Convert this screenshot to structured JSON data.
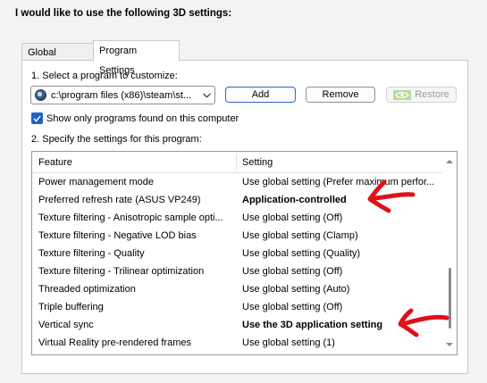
{
  "heading": "I would like to use the following 3D settings:",
  "tabs": [
    {
      "label": "Global Settings",
      "selected": false
    },
    {
      "label": "Program Settings",
      "selected": true
    }
  ],
  "step1": {
    "label": "1. Select a program to customize:",
    "program": "c:\\program files (x86)\\steam\\st...",
    "add_label": "Add",
    "remove_label": "Remove",
    "restore_label": "Restore"
  },
  "filter": {
    "checked": true,
    "label": "Show only programs found on this computer"
  },
  "step2": {
    "label": "2. Specify the settings for this program:",
    "columns": {
      "feature": "Feature",
      "setting": "Setting"
    },
    "rows": [
      {
        "feature": "Power management mode",
        "setting": "Use global setting (Prefer maximum perfor...",
        "bold": false
      },
      {
        "feature": "Preferred refresh rate (ASUS VP249)",
        "setting": "Application-controlled",
        "bold": true
      },
      {
        "feature": "Texture filtering - Anisotropic sample opti...",
        "setting": "Use global setting (Off)",
        "bold": false
      },
      {
        "feature": "Texture filtering - Negative LOD bias",
        "setting": "Use global setting (Clamp)",
        "bold": false
      },
      {
        "feature": "Texture filtering - Quality",
        "setting": "Use global setting (Quality)",
        "bold": false
      },
      {
        "feature": "Texture filtering - Trilinear optimization",
        "setting": "Use global setting (Off)",
        "bold": false
      },
      {
        "feature": "Threaded optimization",
        "setting": "Use global setting (Auto)",
        "bold": false
      },
      {
        "feature": "Triple buffering",
        "setting": "Use global setting (Off)",
        "bold": false
      },
      {
        "feature": "Vertical sync",
        "setting": "Use the 3D application setting",
        "bold": true
      },
      {
        "feature": "Virtual Reality pre-rendered frames",
        "setting": "Use global setting (1)",
        "bold": false
      }
    ]
  },
  "colors": {
    "accent": "#1f62c7",
    "annotation": "#e0101a"
  },
  "icons": {
    "program": "steam-program-icon",
    "restore": "nvidia-logo-icon",
    "dropdown": "chevron-down-icon",
    "checkbox": "checkmark-icon"
  }
}
